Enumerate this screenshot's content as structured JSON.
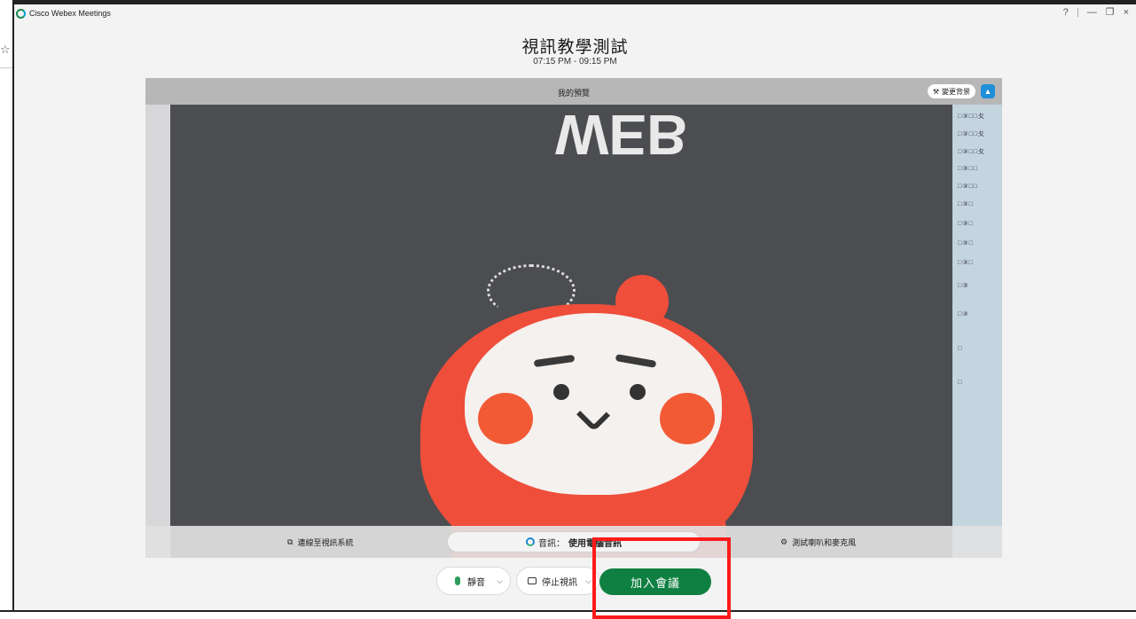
{
  "window": {
    "app_title": "Cisco Webex Meetings",
    "controls": {
      "help": "?",
      "minimize": "—",
      "restore": "❐",
      "close": "×"
    }
  },
  "meeting": {
    "title": "視訊教學測試",
    "time": "07:15 PM - 09:15 PM"
  },
  "preview": {
    "label": "我的預覽",
    "change_background": "變更背景",
    "scene_text": "WEB",
    "side_rows": [
      "□③□□夂",
      "□③□□夂",
      "□③□□夂",
      "□③□□",
      "□③□□",
      "□③□",
      "□③□",
      "□③□",
      "□③□",
      "□③",
      "□③",
      "□",
      "□"
    ]
  },
  "footer": {
    "video_system": "連線至視訊系統",
    "audio_prefix": "音訊：",
    "audio_value": "使用電腦音訊",
    "test": "測試喇叭和麥克風"
  },
  "controls": {
    "mute": "靜音",
    "stop_video": "停止視訊",
    "join": "加入會議"
  },
  "colors": {
    "join_green": "#0f8041",
    "highlight_red": "#ff1a1a",
    "accent_blue": "#1e8fd8"
  }
}
